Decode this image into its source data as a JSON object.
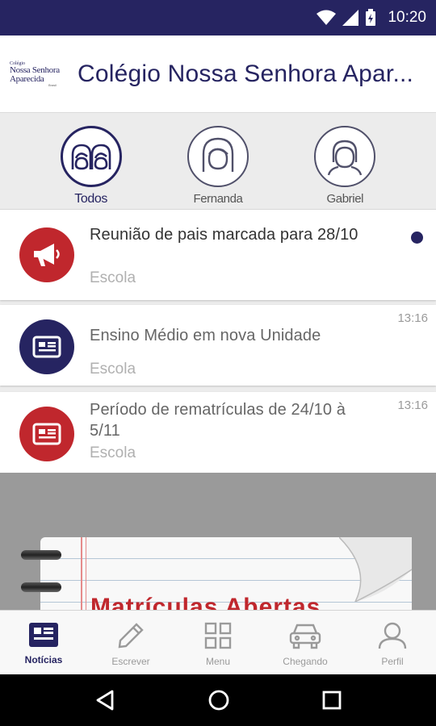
{
  "status_bar": {
    "time": "10:20"
  },
  "app_bar": {
    "logo": {
      "line1": "Colégio",
      "line2": "Nossa Senhora",
      "line3": "Aparecida",
      "line4": "Brasil"
    },
    "title": "Colégio Nossa Senhora Apar..."
  },
  "profiles": [
    {
      "label": "Todos",
      "active": true,
      "icon": "group-icon"
    },
    {
      "label": "Fernanda",
      "active": false,
      "icon": "girl-avatar-icon"
    },
    {
      "label": "Gabriel",
      "active": false,
      "icon": "boy-avatar-icon"
    }
  ],
  "feed": [
    {
      "title": "Reunião de pais marcada para 28/10",
      "source": "Escola",
      "time": "",
      "unread": true,
      "icon": "megaphone-icon",
      "color": "#c0272d"
    },
    {
      "title": "Ensino Médio em nova Unidade",
      "source": "Escola",
      "time": "13:16",
      "unread": false,
      "icon": "news-icon",
      "color": "#262461"
    },
    {
      "title": "Período de rematrículas de 24/10 à 5/11",
      "source": "Escola",
      "time": "13:16",
      "unread": false,
      "icon": "news-icon",
      "color": "#c0272d"
    }
  ],
  "banner": {
    "text": "Matrículas Abertas"
  },
  "bottom_nav": [
    {
      "label": "Notícias",
      "icon": "news-icon",
      "active": true
    },
    {
      "label": "Escrever",
      "icon": "pencil-icon",
      "active": false
    },
    {
      "label": "Menu",
      "icon": "grid-icon",
      "active": false
    },
    {
      "label": "Chegando",
      "icon": "car-icon",
      "active": false
    },
    {
      "label": "Perfil",
      "icon": "person-icon",
      "active": false
    }
  ],
  "colors": {
    "primary": "#262461",
    "accent": "#c0272d",
    "muted": "#9a9a9a"
  }
}
